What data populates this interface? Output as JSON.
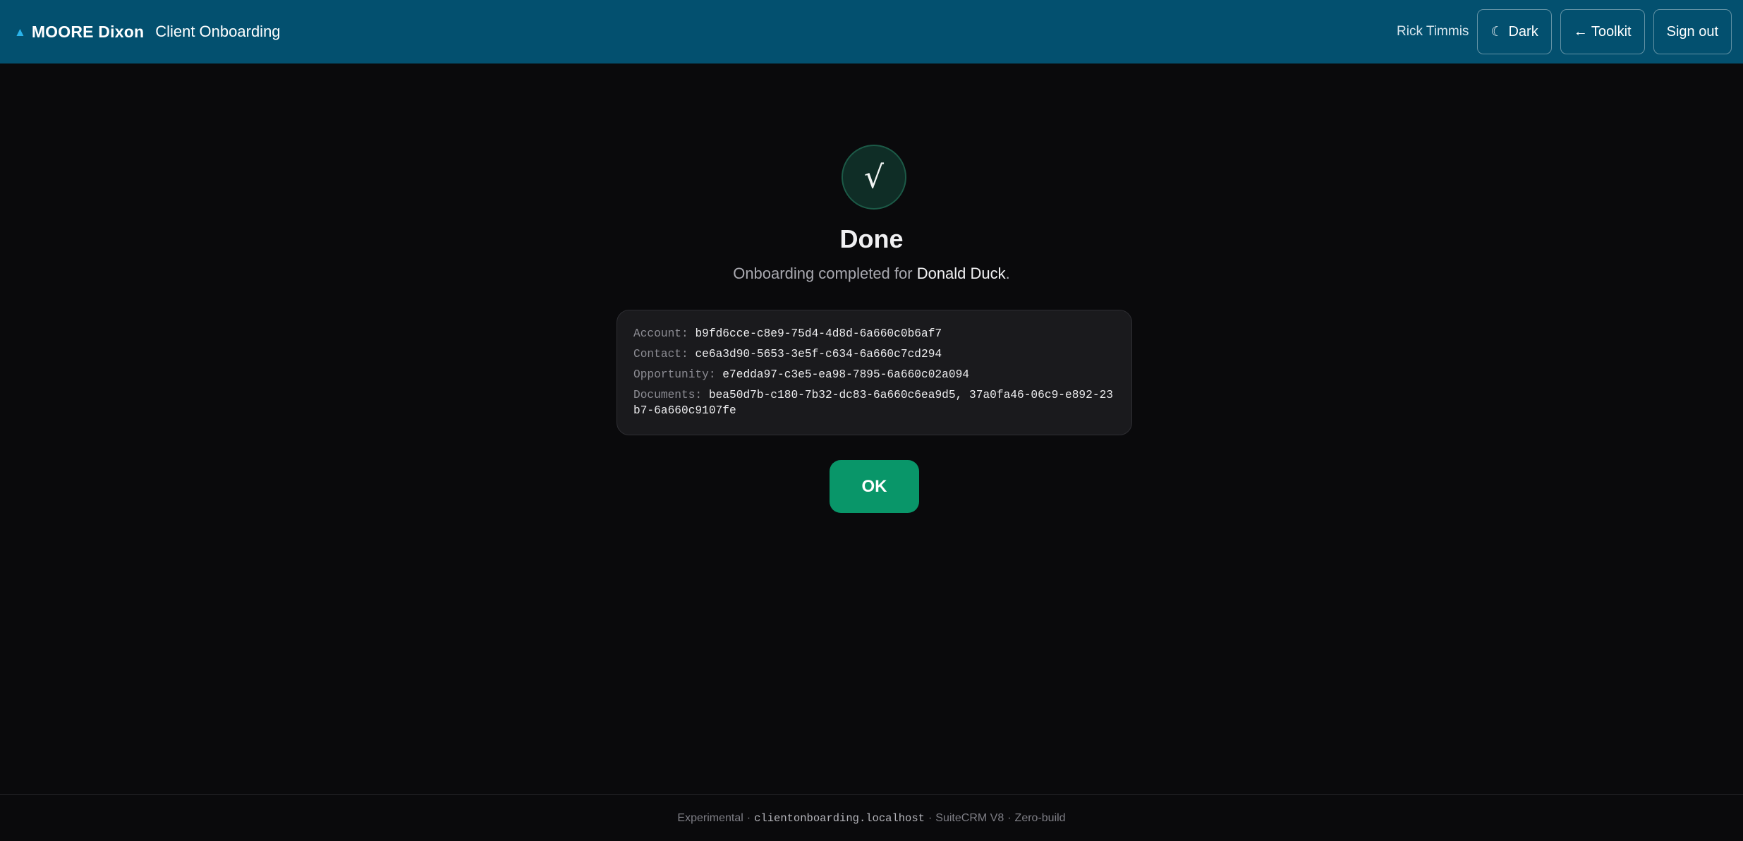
{
  "header": {
    "logo_icon": "triangle-up-icon",
    "brand_name": "MOORE Dixon",
    "app_name": "Client Onboarding",
    "user_name": "Rick Timmis",
    "theme_icon": "☾",
    "theme_label": "Dark",
    "toolkit_label": "← Toolkit",
    "signout_label": "Sign out"
  },
  "result": {
    "icon": "√",
    "title": "Done",
    "message_prefix": "Onboarding completed for ",
    "client_name": "Donald Duck",
    "message_suffix": ".",
    "ids": [
      {
        "label": "Account:",
        "value": "b9fd6cce-c8e9-75d4-4d8d-6a660c0b6af7"
      },
      {
        "label": "Contact:",
        "value": "ce6a3d90-5653-3e5f-c634-6a660c7cd294"
      },
      {
        "label": "Opportunity:",
        "value": "e7edda97-c3e5-ea98-7895-6a660c02a094"
      },
      {
        "label": "Documents:",
        "value": "bea50d7b-c180-7b32-dc83-6a660c6ea9d5, 37a0fa46-06c9-e892-23b7-6a660c9107fe"
      }
    ],
    "ok_label": "OK"
  },
  "footer": {
    "part1": "Experimental",
    "host": "clientonboarding.localhost",
    "part3": "SuiteCRM V8",
    "part4": "Zero-build",
    "separator": "·"
  },
  "colors": {
    "header_bg": "#03506f",
    "accent": "#099669",
    "page_bg": "#0a0a0c"
  }
}
